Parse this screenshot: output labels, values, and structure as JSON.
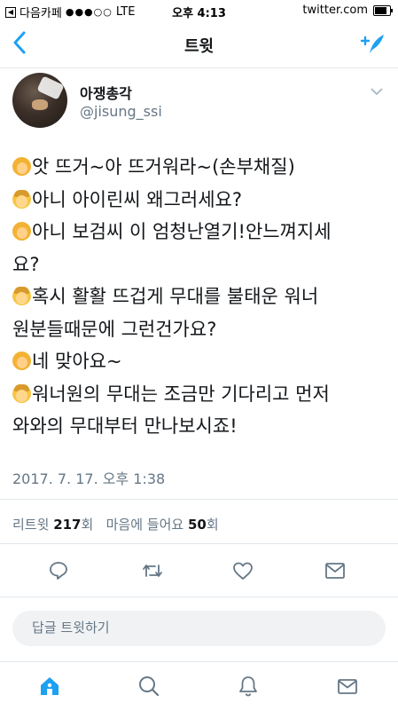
{
  "status_bar": {
    "back_app": "다음카페",
    "signal": "●●●○○",
    "network": "LTE",
    "time": "오후 4:13",
    "url": "twitter.com",
    "battery_level": 0.8
  },
  "nav": {
    "title": "트윗"
  },
  "author": {
    "name": "아쟁총각",
    "handle": "@jisung_ssi"
  },
  "tweet": {
    "lines": [
      {
        "emoji": "girl",
        "text": "앗 뜨거~아 뜨거워라~(손부채질)"
      },
      {
        "emoji": "boy",
        "text": "아니 아이린씨 왜그러세요?"
      },
      {
        "emoji": "girl",
        "text": "아니 보검씨 이 엄청난열기!안느껴지세"
      },
      {
        "emoji": "",
        "text": "요?"
      },
      {
        "emoji": "boy",
        "text": "혹시 활활 뜨겁게 무대를 불태운 워너"
      },
      {
        "emoji": "",
        "text": "원분들때문에 그런건가요?"
      },
      {
        "emoji": "girl",
        "text": "네 맞아요~"
      },
      {
        "emoji": "boy",
        "text": "워너원의 무대는 조금만 기다리고 먼저"
      },
      {
        "emoji": "",
        "text": "와와의 무대부터 만나보시죠!"
      }
    ],
    "timestamp": "2017. 7. 17. 오후 1:38"
  },
  "stats": {
    "retweet_label": "리트윗",
    "retweet_count": "217",
    "retweet_unit": "회",
    "like_label": "마음에 들어요",
    "like_count": "50",
    "like_unit": "회"
  },
  "reply": {
    "placeholder": "답글 트윗하기"
  },
  "colors": {
    "accent": "#1da1f2",
    "muted": "#657786",
    "icon": "#657786"
  }
}
